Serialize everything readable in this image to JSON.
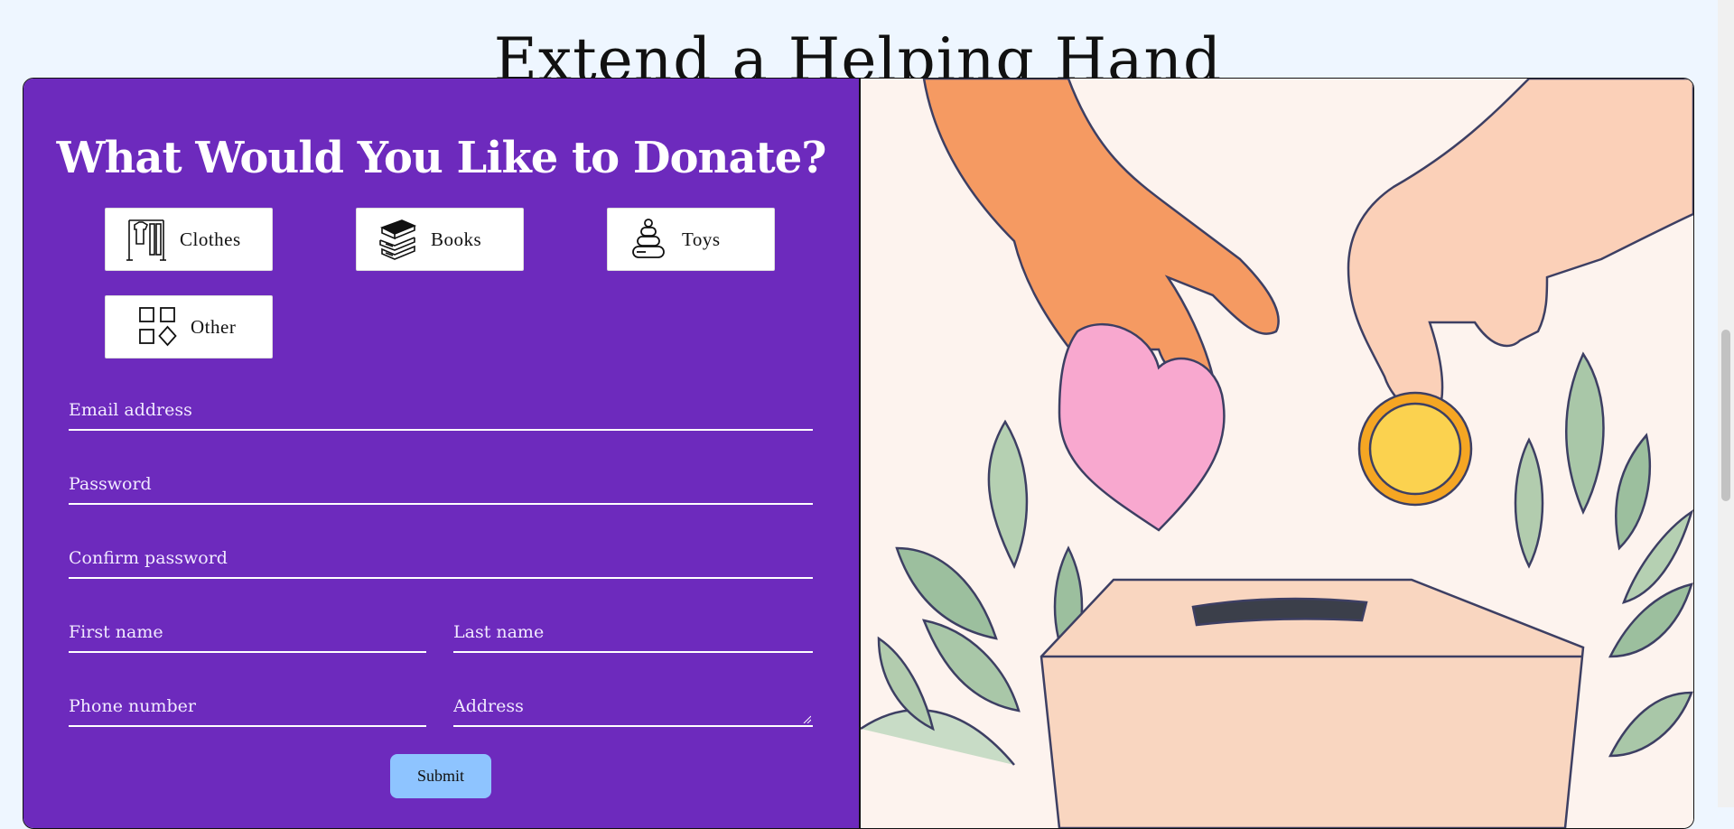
{
  "page": {
    "title": "Extend a Helping Hand"
  },
  "form": {
    "heading": "What Would You Like to Donate?",
    "categories": [
      {
        "label": "Clothes",
        "icon": "clothes-rack-icon"
      },
      {
        "label": "Books",
        "icon": "books-stack-icon"
      },
      {
        "label": "Toys",
        "icon": "stacking-rings-toy-icon"
      },
      {
        "label": "Other",
        "icon": "shapes-grid-icon"
      }
    ],
    "fields": {
      "email": {
        "placeholder": "Email address",
        "value": ""
      },
      "password": {
        "placeholder": "Password",
        "value": ""
      },
      "confirm_password": {
        "placeholder": "Confirm password",
        "value": ""
      },
      "first_name": {
        "placeholder": "First name",
        "value": ""
      },
      "last_name": {
        "placeholder": "Last name",
        "value": ""
      },
      "phone": {
        "placeholder": "Phone number",
        "value": ""
      },
      "address": {
        "placeholder": "Address",
        "value": ""
      }
    },
    "submit_label": "Submit"
  },
  "colors": {
    "page_background": "#eef6ff",
    "form_panel": "#6d2abd",
    "submit_button": "#8ec4ff",
    "illustration_background": "#fdf3ee"
  },
  "illustration": {
    "subject": "hands dropping a heart and a coin into a donation box among leaves"
  }
}
